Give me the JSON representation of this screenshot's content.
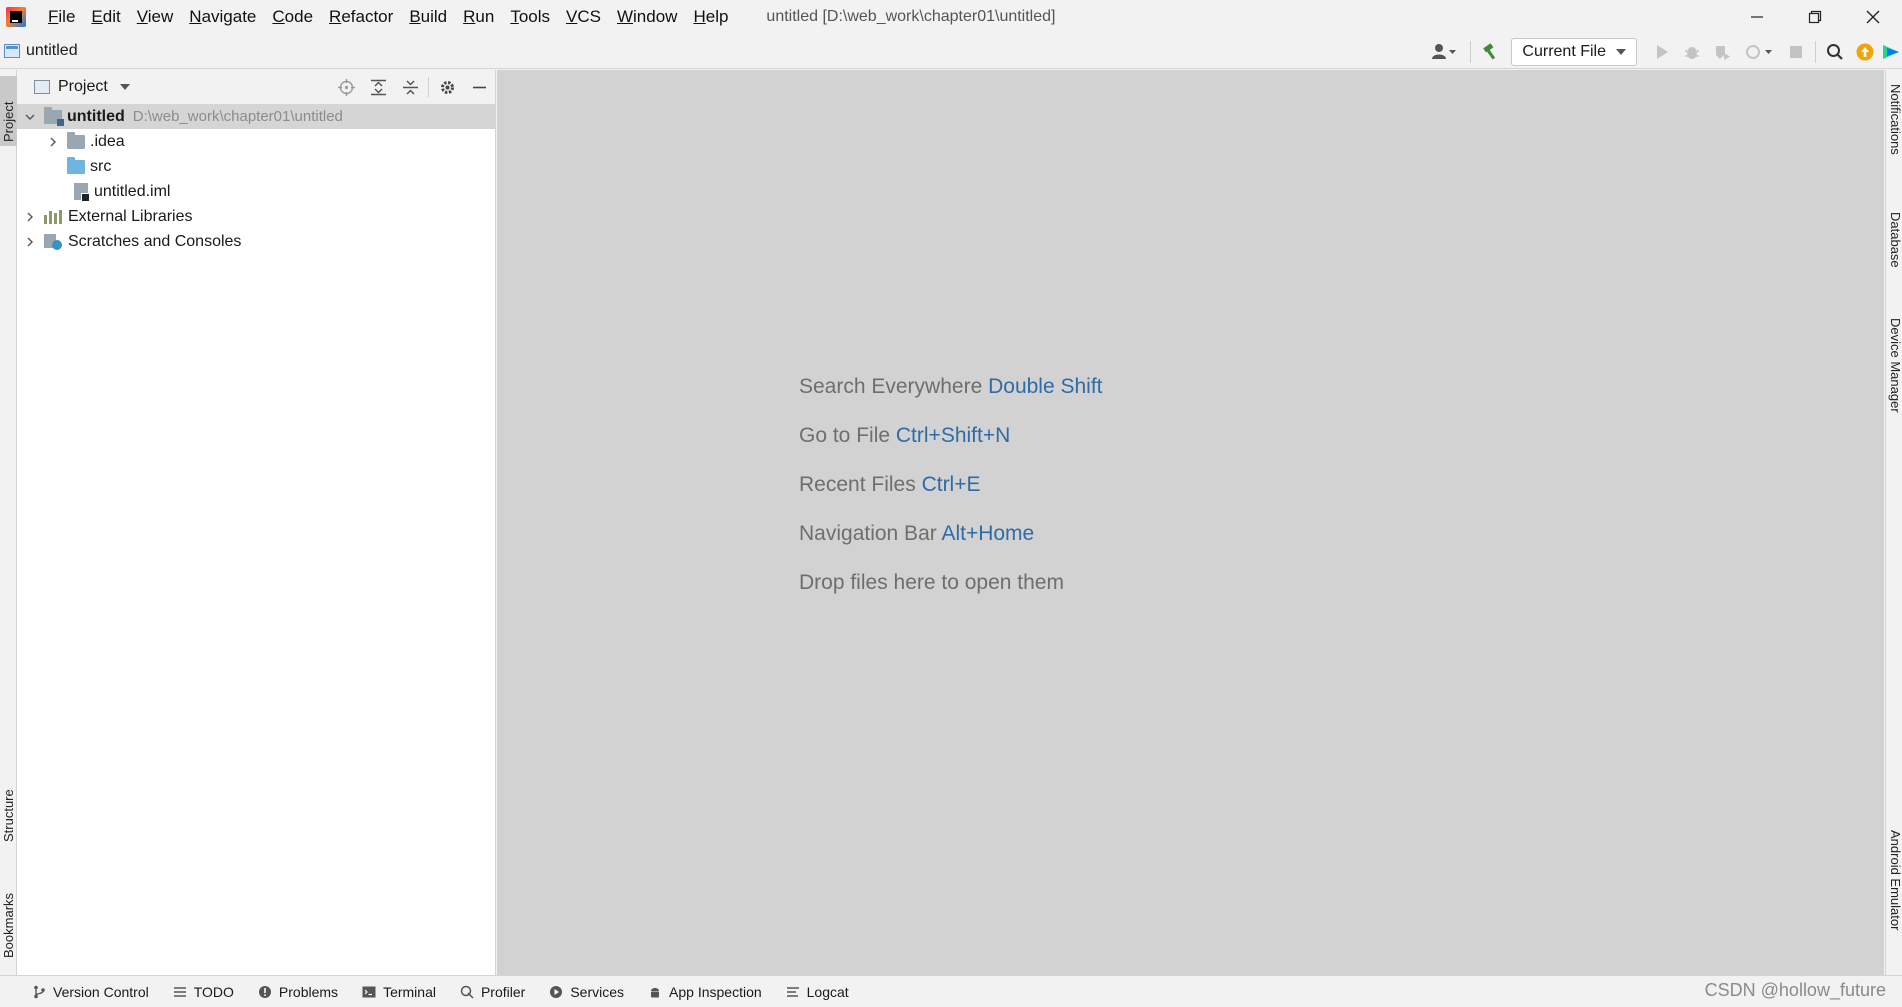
{
  "window": {
    "title": "untitled [D:\\web_work\\chapter01\\untitled]"
  },
  "menu": [
    "File",
    "Edit",
    "View",
    "Navigate",
    "Code",
    "Refactor",
    "Build",
    "Run",
    "Tools",
    "VCS",
    "Window",
    "Help"
  ],
  "navbar": {
    "breadcrumb": "untitled",
    "run_config": "Current File"
  },
  "project_panel": {
    "title": "Project",
    "tree": [
      {
        "label": "untitled",
        "path": "D:\\web_work\\chapter01\\untitled",
        "icon": "module-folder-icon",
        "expanded": true,
        "selected": true
      },
      {
        "label": ".idea",
        "icon": "folder-icon",
        "expanded": false
      },
      {
        "label": "src",
        "icon": "source-folder-icon"
      },
      {
        "label": "untitled.iml",
        "icon": "iml-file-icon"
      },
      {
        "label": "External Libraries",
        "icon": "library-icon",
        "expanded": false
      },
      {
        "label": "Scratches and Consoles",
        "icon": "scratches-icon",
        "expanded": false
      }
    ]
  },
  "left_tool_windows": [
    "Project",
    "Structure",
    "Bookmarks"
  ],
  "right_tool_windows": [
    "Notifications",
    "Database",
    "Device Manager",
    "Android Emulator"
  ],
  "editor_hints": [
    {
      "text": "Search Everywhere",
      "shortcut": "Double Shift"
    },
    {
      "text": "Go to File",
      "shortcut": "Ctrl+Shift+N"
    },
    {
      "text": "Recent Files",
      "shortcut": "Ctrl+E"
    },
    {
      "text": "Navigation Bar",
      "shortcut": "Alt+Home"
    },
    {
      "text": "Drop files here to open them",
      "shortcut": ""
    }
  ],
  "bottom_tabs": [
    "Version Control",
    "TODO",
    "Problems",
    "Terminal",
    "Profiler",
    "Services",
    "App Inspection",
    "Logcat"
  ],
  "watermark": "CSDN @hollow_future",
  "colors": {
    "editor_bg": "#d2d2d2",
    "shortcut": "#2e6ba7",
    "selection": "#d5d5d5",
    "update_badge": "#f0a30a"
  }
}
